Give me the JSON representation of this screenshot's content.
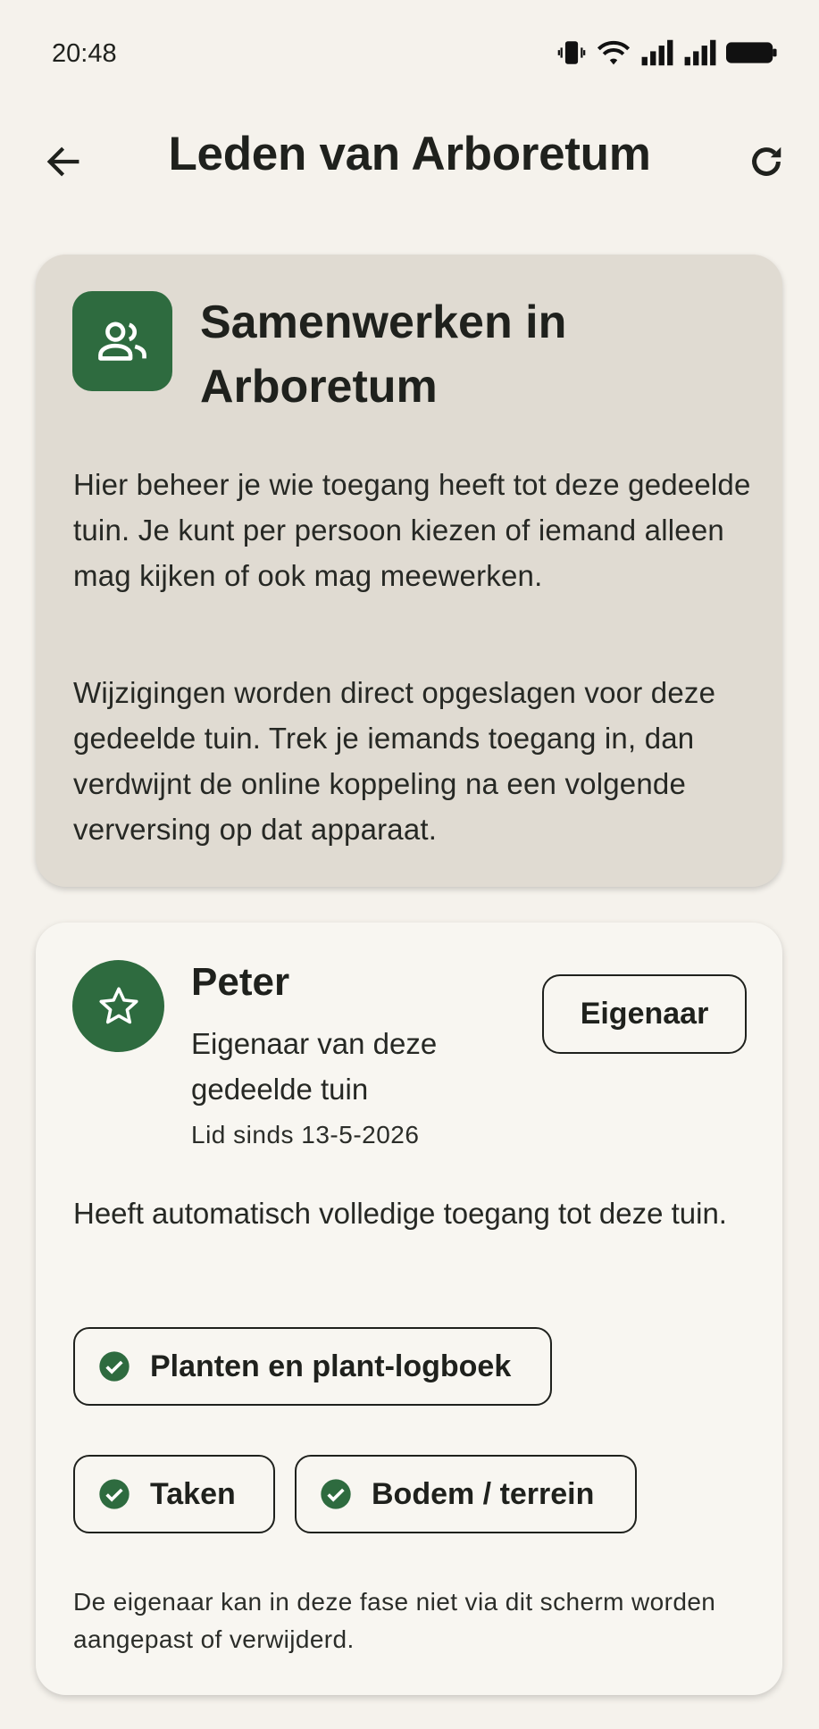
{
  "status": {
    "time": "20:48",
    "icons": [
      "vibrate-icon",
      "wifi-icon",
      "signal-icon",
      "signal-icon",
      "battery-icon"
    ]
  },
  "app_bar": {
    "title": "Leden van Arboretum",
    "back_icon": "arrow-back-icon",
    "refresh_icon": "refresh-icon"
  },
  "info_card": {
    "icon": "group-icon",
    "title": "Samenwerken in Arboretum",
    "paragraph1": "Hier beheer je wie toegang heeft tot deze gedeelde tuin. Je kunt per persoon kiezen of iemand alleen mag kijken of ook mag meewerken.",
    "paragraph2": "Wijzigingen worden direct opgeslagen voor deze gedeelde tuin. Trek je iemands toegang in, dan verdwijnt de online koppeling na een volgende verversing op dat apparaat."
  },
  "member": {
    "avatar_icon": "star-icon",
    "name": "Peter",
    "role_description": "Eigenaar van deze gedeelde tuin",
    "member_since": "Lid sinds 13-5-2026",
    "role_button": "Eigenaar",
    "access_text": "Heeft automatisch volledige toegang tot deze tuin.",
    "permissions": [
      "Planten en plant-logboek",
      "Taken",
      "Bodem / terrein"
    ],
    "footnote": "De eigenaar kan in deze fase niet via dit scherm worden aangepast of verwijderd."
  },
  "colors": {
    "background": "#f5f2ec",
    "info_card": "#e0dbd2",
    "accent_green": "#2e6b3f",
    "text": "#1f211d"
  }
}
